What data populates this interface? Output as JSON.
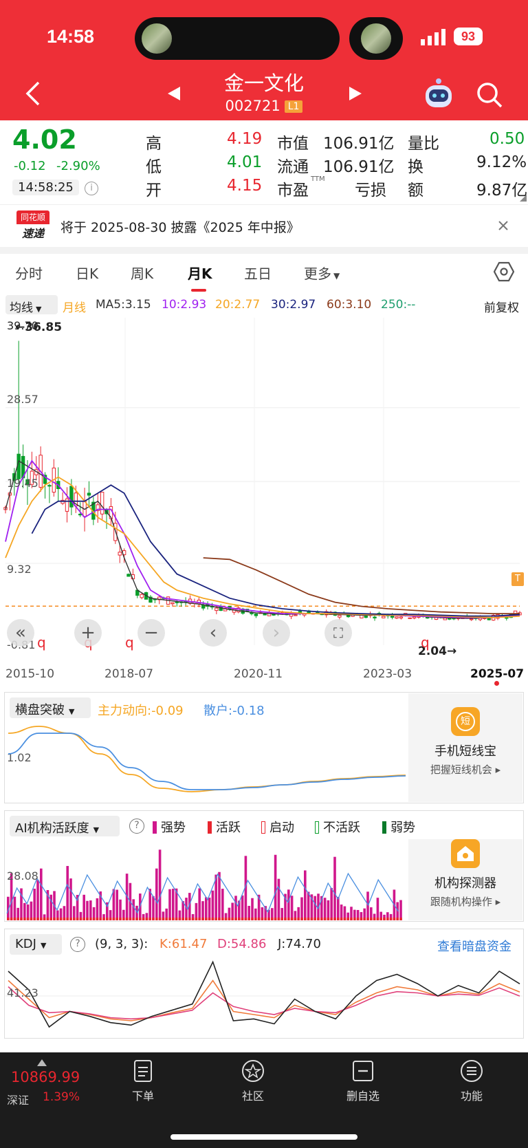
{
  "status": {
    "time": "14:58",
    "battery": "93"
  },
  "header": {
    "stock_name": "金一文化",
    "stock_code": "002721",
    "level": "L1"
  },
  "quote": {
    "price": "4.02",
    "change": "-0.12",
    "change_pct": "-2.90%",
    "quote_time": "14:58:25",
    "high_label": "高",
    "high": "4.19",
    "low_label": "低",
    "low": "4.01",
    "open_label": "开",
    "open": "4.15",
    "mktcap_label": "市值",
    "mktcap": "106.91亿",
    "float_label": "流通",
    "float": "106.91亿",
    "pe_label": "市盈",
    "pe_sup": "TTM",
    "pe": "亏损",
    "volratio_label": "量比",
    "volratio": "0.50",
    "turnover_label": "换",
    "turnover": "9.12%",
    "amount_label": "额",
    "amount": "9.87亿"
  },
  "news": {
    "badge_top": "同花顺",
    "badge_bottom": "速递",
    "text": "将于 2025-08-30 披露《2025 年中报》"
  },
  "tabs": [
    "分时",
    "日K",
    "周K",
    "月K",
    "五日",
    "更多"
  ],
  "ma_bar": {
    "select": "均线",
    "period": "月线",
    "ma5": "MA5:3.15",
    "ma10": "10:2.93",
    "ma20": "20:2.77",
    "ma30": "30:2.97",
    "ma60": "60:3.10",
    "ma250": "250:--",
    "adjust": "前复权"
  },
  "kline": {
    "max_label": "36.85",
    "min_label": "2.04",
    "y_labels": [
      "39.70",
      "28.57",
      "19.45",
      "9.32",
      "-0.81"
    ],
    "x_labels": [
      "2015-10",
      "2018-07",
      "2020-11",
      "2023-03",
      "2025-07"
    ],
    "markers": [
      "q",
      "q",
      "q",
      "q"
    ],
    "t_badge": "T"
  },
  "chart_data": [
    {
      "type": "line",
      "title": "",
      "x": [
        2015.75,
        2016.0,
        2016.25,
        2016.5,
        2016.75,
        2017.0,
        2017.25,
        2017.5,
        2017.75,
        2018.0,
        2018.25,
        2018.5,
        2018.75,
        2019.0,
        2019.5,
        2020.0,
        2020.5,
        2021.0,
        2021.5,
        2022.0,
        2022.5,
        2023.0,
        2023.5,
        2024.0,
        2024.5,
        2025.0,
        2025.5
      ],
      "series": [
        {
          "name": "MA5",
          "values": [
            16,
            22,
            21,
            20,
            19,
            17,
            16,
            17,
            15,
            10,
            6,
            5,
            4.8,
            4.6,
            4.2,
            3.6,
            3.2,
            3.0,
            3.1,
            3.0,
            2.9,
            2.9,
            2.8,
            2.6,
            2.5,
            2.6,
            3.15
          ]
        },
        {
          "name": "MA10",
          "values": [
            12,
            19,
            22,
            20,
            19,
            17,
            15,
            16,
            16,
            13,
            9,
            6,
            5,
            4.8,
            4.4,
            3.8,
            3.4,
            3.1,
            3.1,
            3.1,
            3.0,
            2.9,
            2.8,
            2.7,
            2.6,
            2.6,
            2.93
          ]
        },
        {
          "name": "MA20",
          "values": [
            10,
            14,
            17,
            19,
            20,
            19,
            17,
            15,
            14,
            13,
            11,
            9,
            7,
            6,
            5,
            4.3,
            3.8,
            3.3,
            3.1,
            3.1,
            3.0,
            2.9,
            2.9,
            2.8,
            2.7,
            2.6,
            2.77
          ]
        },
        {
          "name": "MA30",
          "values": [
            null,
            null,
            13,
            16,
            17,
            17,
            17,
            18,
            19,
            18,
            15,
            12,
            10,
            8,
            6.5,
            5,
            4.2,
            3.7,
            3.4,
            3.2,
            3.1,
            3.0,
            3.0,
            2.9,
            2.8,
            2.8,
            2.97
          ]
        },
        {
          "name": "MA60",
          "values": [
            null,
            null,
            null,
            null,
            null,
            null,
            null,
            null,
            null,
            null,
            null,
            null,
            null,
            null,
            10,
            9.8,
            8.5,
            7,
            5.5,
            4.5,
            4,
            3.7,
            3.5,
            3.3,
            3.2,
            3.1,
            3.1
          ]
        }
      ],
      "ylim": [
        -0.81,
        39.7
      ]
    },
    {
      "type": "line",
      "title": "",
      "series": [
        {
          "name": "主力动向",
          "values": [
            9,
            10,
            9,
            6,
            3,
            1,
            0.5,
            0.8,
            1.2,
            1.5,
            2,
            2.4,
            2.7,
            2.9
          ]
        },
        {
          "name": "散户",
          "values": [
            6,
            9,
            9,
            7,
            4,
            2,
            0.8,
            0.8,
            1.1,
            1.5,
            1.9,
            2.3,
            2.6,
            2.8
          ]
        }
      ],
      "y_label": "1.02"
    },
    {
      "type": "bar",
      "title": "",
      "y_label": "28.08"
    },
    {
      "type": "line",
      "title": "",
      "series": [
        {
          "name": "K",
          "values": [
            80,
            50,
            20,
            30,
            25,
            18,
            15,
            20,
            28,
            35,
            80,
            30,
            25,
            20,
            40,
            30,
            25,
            45,
            60,
            70,
            65,
            55,
            62,
            58,
            75,
            61.47
          ]
        },
        {
          "name": "D",
          "values": [
            70,
            40,
            28,
            30,
            26,
            20,
            18,
            20,
            26,
            32,
            60,
            38,
            30,
            25,
            35,
            30,
            28,
            40,
            55,
            62,
            60,
            55,
            58,
            56,
            68,
            54.86
          ]
        },
        {
          "name": "J",
          "values": [
            95,
            65,
            5,
            30,
            22,
            12,
            8,
            22,
            32,
            42,
            110,
            15,
            18,
            10,
            50,
            30,
            18,
            55,
            80,
            90,
            75,
            55,
            72,
            60,
            95,
            74.7
          ]
        }
      ],
      "y_label": "41.23"
    }
  ],
  "panel_hp": {
    "select": "横盘突破",
    "main": "主力动向:-0.09",
    "retail": "散户:-0.18",
    "y_label": "1.02",
    "card_title": "手机短线宝",
    "card_sub": "把握短线机会 ▸",
    "card_icon": "短"
  },
  "panel_ai": {
    "select": "AI机构活跃度",
    "legend": [
      "强势",
      "活跃",
      "启动",
      "不活跃",
      "弱势"
    ],
    "y_label": "28.08",
    "card_title": "机构探测器",
    "card_sub": "跟随机构操作 ▸"
  },
  "panel_kdj": {
    "select": "KDJ",
    "params": "(9, 3, 3):",
    "k": "K:61.47",
    "d": "D:54.86",
    "j": "J:74.70",
    "link": "查看暗盘资金",
    "y_label": "41.23"
  },
  "bottom": {
    "index_value": "10869.99",
    "index_name": "深证",
    "index_pct": "1.39%",
    "items": [
      "下单",
      "社区",
      "删自选",
      "功能"
    ]
  },
  "colors": {
    "up": "#e8262f",
    "down": "#0a9e2a",
    "ma5": "#333333",
    "ma10": "#a020f0",
    "ma20": "#f5a623",
    "ma30": "#1a237e",
    "ma60": "#8b3a1a",
    "header": "#ee2f37"
  }
}
